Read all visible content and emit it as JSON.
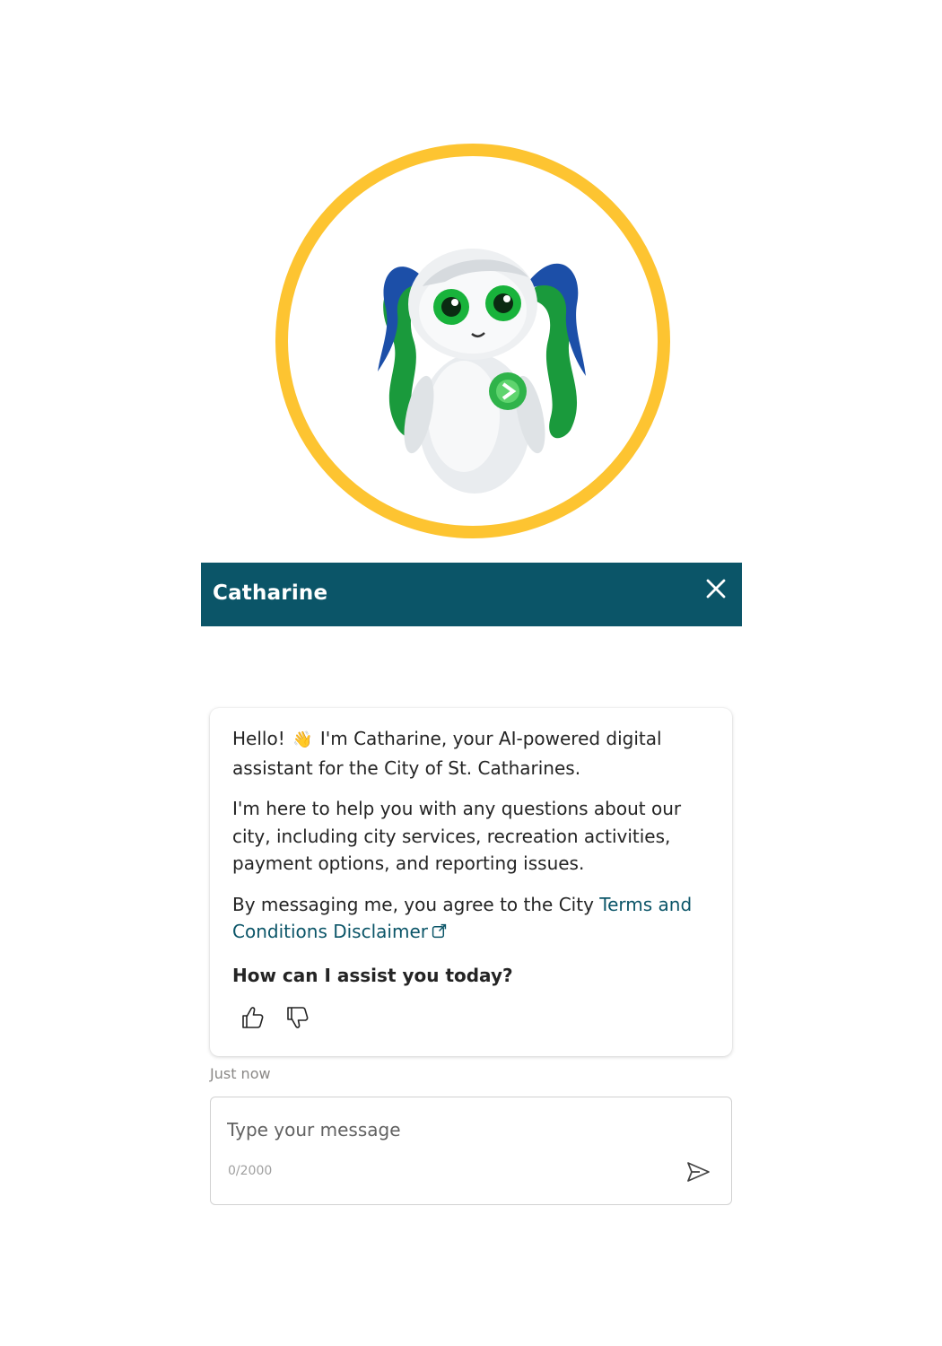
{
  "colors": {
    "accent": "#0b5568",
    "avatar_ring": "#fdc431",
    "text": "#242424",
    "muted": "#8a8886"
  },
  "avatar": {
    "icon": "robot-avatar-icon"
  },
  "header": {
    "title": "Catharine",
    "close_icon": "close-icon"
  },
  "message": {
    "greeting_before": "Hello!",
    "greeting_emoji": "👋",
    "greeting_after": "I'm Catharine, your AI-powered digital assistant for the City of St. Catharines.",
    "help_text": "I'm here to help you with any questions about our city, including city services, recreation activities, payment options, and reporting issues.",
    "terms_prefix": "By messaging me, you agree to the City ",
    "terms_link": "Terms and Conditions Disclaimer",
    "question": "How can I assist you today?",
    "timestamp": "Just now"
  },
  "feedback": {
    "thumbs_up_icon": "thumbs-up-icon",
    "thumbs_down_icon": "thumbs-down-icon"
  },
  "composer": {
    "placeholder": "Type your message",
    "counter": "0/2000",
    "send_icon": "send-icon"
  }
}
